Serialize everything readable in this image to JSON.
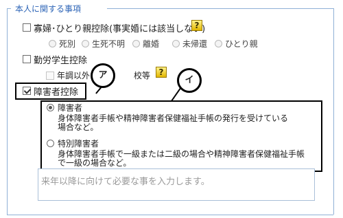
{
  "section": {
    "title": "本人に関する事項"
  },
  "widow": {
    "label": "寡婦･ひとり親控除(事実婚には該当しない)",
    "help_glyph": "?",
    "options": [
      "死別",
      "生死不明",
      "離婚",
      "未帰還",
      "ひとり親"
    ]
  },
  "working_student": {
    "label": "勤労学生控除",
    "sub_label_before": "年調以外",
    "sub_label_after": "校等",
    "help_glyph": "?"
  },
  "disability": {
    "label": "障害者控除",
    "checked": true,
    "options": [
      {
        "title": "障害者",
        "selected": true,
        "description_line1": "身体障害者手帳や精神障害者保健福祉手帳の発行を受けている",
        "description_line2": "場合など。"
      },
      {
        "title": "特別障害者",
        "selected": false,
        "description_line1": "身体障害者手帳で一級または二級の場合や精神障害者保健福祉手帳",
        "description_line2": "で一級の場合など。"
      }
    ]
  },
  "memo": {
    "placeholder": "来年以降に向けて必要な事を入力します。"
  },
  "callouts": {
    "a": "ア",
    "i": "イ"
  }
}
